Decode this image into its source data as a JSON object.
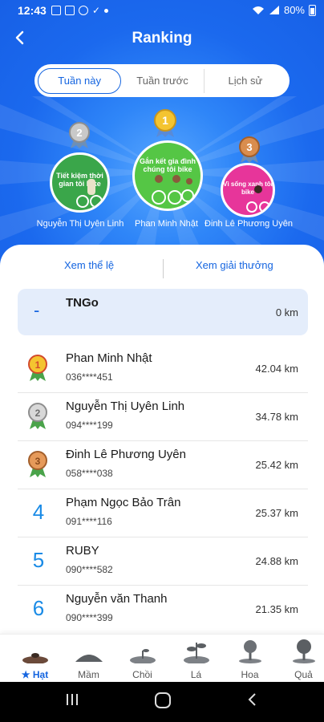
{
  "status_bar": {
    "time": "12:43",
    "battery": "80%",
    "icons": [
      "gallery-icon",
      "message-icon",
      "skype-icon",
      "check-icon",
      "dot-icon",
      "wifi-icon",
      "signal-icon",
      "battery-icon"
    ]
  },
  "header": {
    "title": "Ranking",
    "back_icon": "chevron-left-icon"
  },
  "tabs": [
    {
      "label": "Tuần này",
      "active": true
    },
    {
      "label": "Tuần trước",
      "active": false
    },
    {
      "label": "Lịch sử",
      "active": false
    }
  ],
  "podium": [
    {
      "rank": "2",
      "name": "Nguyễn Thị Uyên Linh",
      "banner": "Tiết kiệm thời gian tôi bike",
      "medal_color": "#a9a9a9"
    },
    {
      "rank": "1",
      "name": "Phan Minh Nhật",
      "banner": "Gắn kết gia đình chúng tôi bike",
      "medal_color": "#e6b422"
    },
    {
      "rank": "3",
      "name": "Đinh Lê Phương Uyên",
      "banner": "Vì sống xanh tôi bike",
      "medal_color": "#c8713a"
    }
  ],
  "links": {
    "rules": "Xem thể lệ",
    "prizes": "Xem giải thưởng"
  },
  "self": {
    "rank": "-",
    "name": "TNGo",
    "km": "0 km"
  },
  "rankings": [
    {
      "rank": "1",
      "name": "Phan Minh Nhật",
      "phone": "036****451",
      "km": "42.04 km",
      "medal": "gold"
    },
    {
      "rank": "2",
      "name": "Nguyễn Thị Uyên Linh",
      "phone": "094****199",
      "km": "34.78 km",
      "medal": "silver"
    },
    {
      "rank": "3",
      "name": "Đinh Lê Phương Uyên",
      "phone": "058****038",
      "km": "25.42 km",
      "medal": "bronze"
    },
    {
      "rank": "4",
      "name": "Phạm Ngọc Bảo Trân",
      "phone": "091****116",
      "km": "25.37 km",
      "medal": ""
    },
    {
      "rank": "5",
      "name": "RUBY",
      "phone": "090****582",
      "km": "24.88 km",
      "medal": ""
    },
    {
      "rank": "6",
      "name": "Nguyễn văn Thanh",
      "phone": "090****399",
      "km": "21.35 km",
      "medal": ""
    }
  ],
  "bottom_nav": [
    {
      "label": "★ Hạt",
      "icon": "seed-icon",
      "active": true
    },
    {
      "label": "Mầm",
      "icon": "sprout-mound-icon",
      "active": false
    },
    {
      "label": "Chồi",
      "icon": "bud-icon",
      "active": false
    },
    {
      "label": "Lá",
      "icon": "leaf-plant-icon",
      "active": false
    },
    {
      "label": "Hoa",
      "icon": "flower-tree-icon",
      "active": false
    },
    {
      "label": "Quả",
      "icon": "fruit-tree-icon",
      "active": false
    }
  ],
  "system_nav": {
    "recent": "recent-apps-icon",
    "home": "home-icon",
    "back": "back-icon"
  },
  "colors": {
    "primary_blue": "#1b69ee",
    "accent_blue": "#1565e0",
    "gold": "#e6b422",
    "silver": "#a9a9a9",
    "bronze": "#c8713a"
  }
}
